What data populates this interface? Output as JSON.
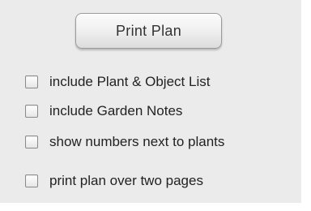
{
  "print_button": {
    "label": "Print Plan"
  },
  "options": [
    {
      "label": "include Plant & Object List",
      "checked": false
    },
    {
      "label": "include Garden Notes",
      "checked": false
    },
    {
      "label": "show numbers next to plants",
      "checked": false
    },
    {
      "label": "print plan over two pages",
      "checked": false
    }
  ]
}
